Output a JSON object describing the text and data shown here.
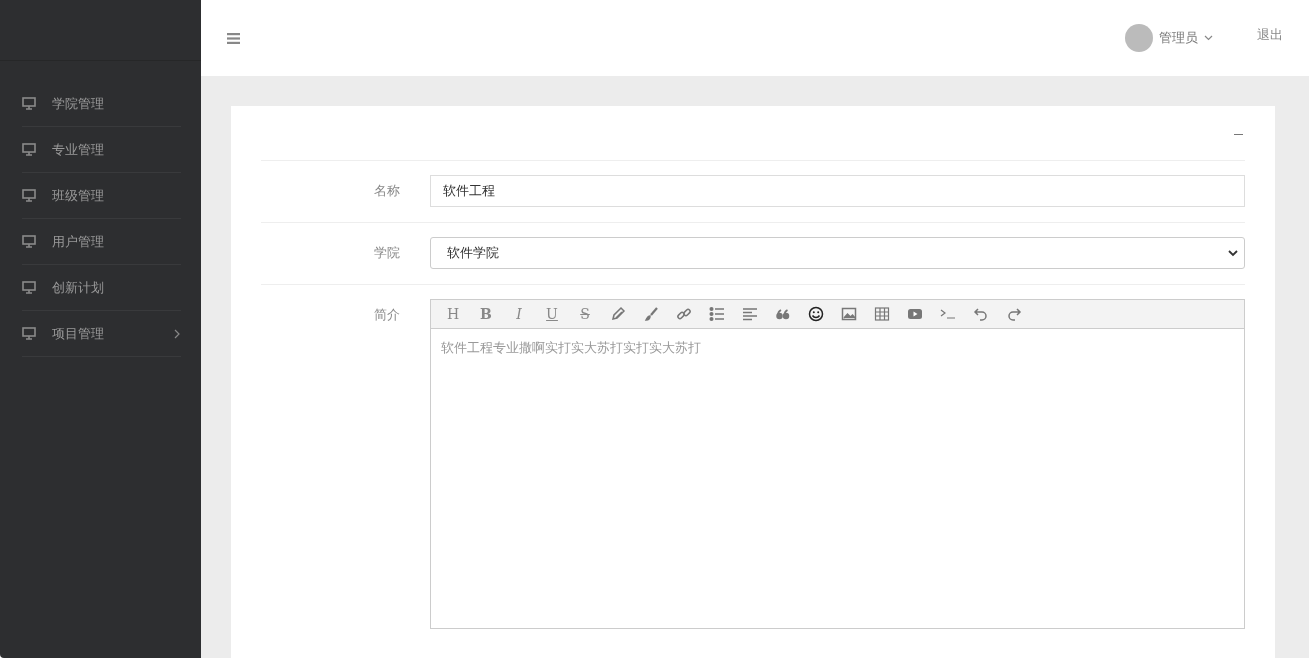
{
  "sidebar": {
    "items": [
      {
        "label": "学院管理",
        "has_submenu": false
      },
      {
        "label": "专业管理",
        "has_submenu": false
      },
      {
        "label": "班级管理",
        "has_submenu": false
      },
      {
        "label": "用户管理",
        "has_submenu": false
      },
      {
        "label": "创新计划",
        "has_submenu": false
      },
      {
        "label": "项目管理",
        "has_submenu": true
      }
    ]
  },
  "header": {
    "user": "管理员",
    "logout": "退出"
  },
  "form": {
    "name": {
      "label": "名称",
      "value": "软件工程"
    },
    "college": {
      "label": "学院",
      "value": "软件学院"
    },
    "intro": {
      "label": "简介",
      "toolbar_letters": [
        "H",
        "B",
        "I",
        "U",
        "S"
      ],
      "value": "软件工程专业撒啊实打实大苏打实打实大苏打"
    }
  }
}
